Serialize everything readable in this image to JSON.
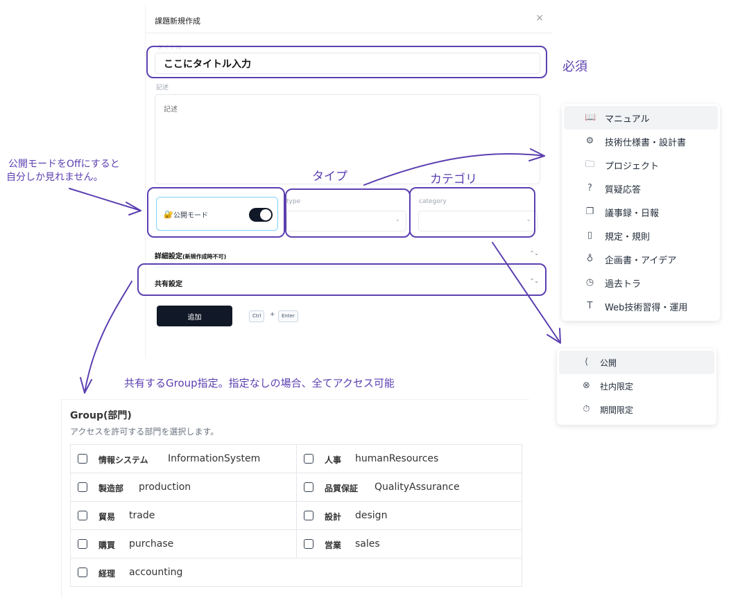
{
  "dialog": {
    "title": "課題新規作成",
    "close": "×",
    "title_label": "タイトル",
    "title_value": "ここにタイトル入力",
    "desc_label": "記述",
    "desc_placeholder": "記述",
    "public_mode_label": "公開モード",
    "public_mode_on": true,
    "type_label": "type",
    "category_label": "category",
    "advanced_label": "詳細設定",
    "advanced_note": "(新規作成時不可)",
    "share_label": "共有設定",
    "add_button": "追加",
    "kbd_ctrl": "Ctrl",
    "kbd_plus": "+",
    "kbd_enter": "Enter"
  },
  "annotations": {
    "required": "必須",
    "public_note_1": "公開モードをOffにすると",
    "public_note_2": "自分しか見れません。",
    "type": "タイプ",
    "category": "カテゴリ",
    "group_note": "共有するGroup指定。指定なしの場合、全てアクセス可能",
    "color": "#5b3fb0"
  },
  "type_menu": [
    {
      "icon": "book-open-icon",
      "label": "マニュアル",
      "glyph": "📖"
    },
    {
      "icon": "gear-icon",
      "label": "技術仕様書・設計書",
      "glyph": "⚙"
    },
    {
      "icon": "folder-search-icon",
      "label": "プロジェクト",
      "glyph": "🗀"
    },
    {
      "icon": "question-bubble-icon",
      "label": "質疑応答",
      "glyph": "?"
    },
    {
      "icon": "copy-files-icon",
      "label": "議事録・日報",
      "glyph": "❐"
    },
    {
      "icon": "book-check-icon",
      "label": "規定・規則",
      "glyph": "▯"
    },
    {
      "icon": "lightbulb-icon",
      "label": "企画書・アイデア",
      "glyph": "♁"
    },
    {
      "icon": "file-clock-icon",
      "label": "過去トラ",
      "glyph": "◷"
    },
    {
      "icon": "text-box-icon",
      "label": "Web技術習得・運用",
      "glyph": "T"
    }
  ],
  "category_menu": [
    {
      "icon": "share-icon",
      "label": "公開",
      "glyph": "⟨"
    },
    {
      "icon": "shield-x-icon",
      "label": "社内限定",
      "glyph": "⊗"
    },
    {
      "icon": "timer-icon",
      "label": "期間限定",
      "glyph": "⏱"
    }
  ],
  "group_panel": {
    "title": "Group(部門)",
    "subtitle": "アクセスを許可する部門を選択します。",
    "groups": [
      {
        "ja": "情報システム",
        "en": "InformationSystem"
      },
      {
        "ja": "人事",
        "en": "humanResources"
      },
      {
        "ja": "製造部",
        "en": "production"
      },
      {
        "ja": "品質保証",
        "en": "QualityAssurance"
      },
      {
        "ja": "貿易",
        "en": "trade"
      },
      {
        "ja": "設計",
        "en": "design"
      },
      {
        "ja": "購買",
        "en": "purchase"
      },
      {
        "ja": "営業",
        "en": "sales"
      },
      {
        "ja": "経理",
        "en": "accounting"
      }
    ]
  }
}
